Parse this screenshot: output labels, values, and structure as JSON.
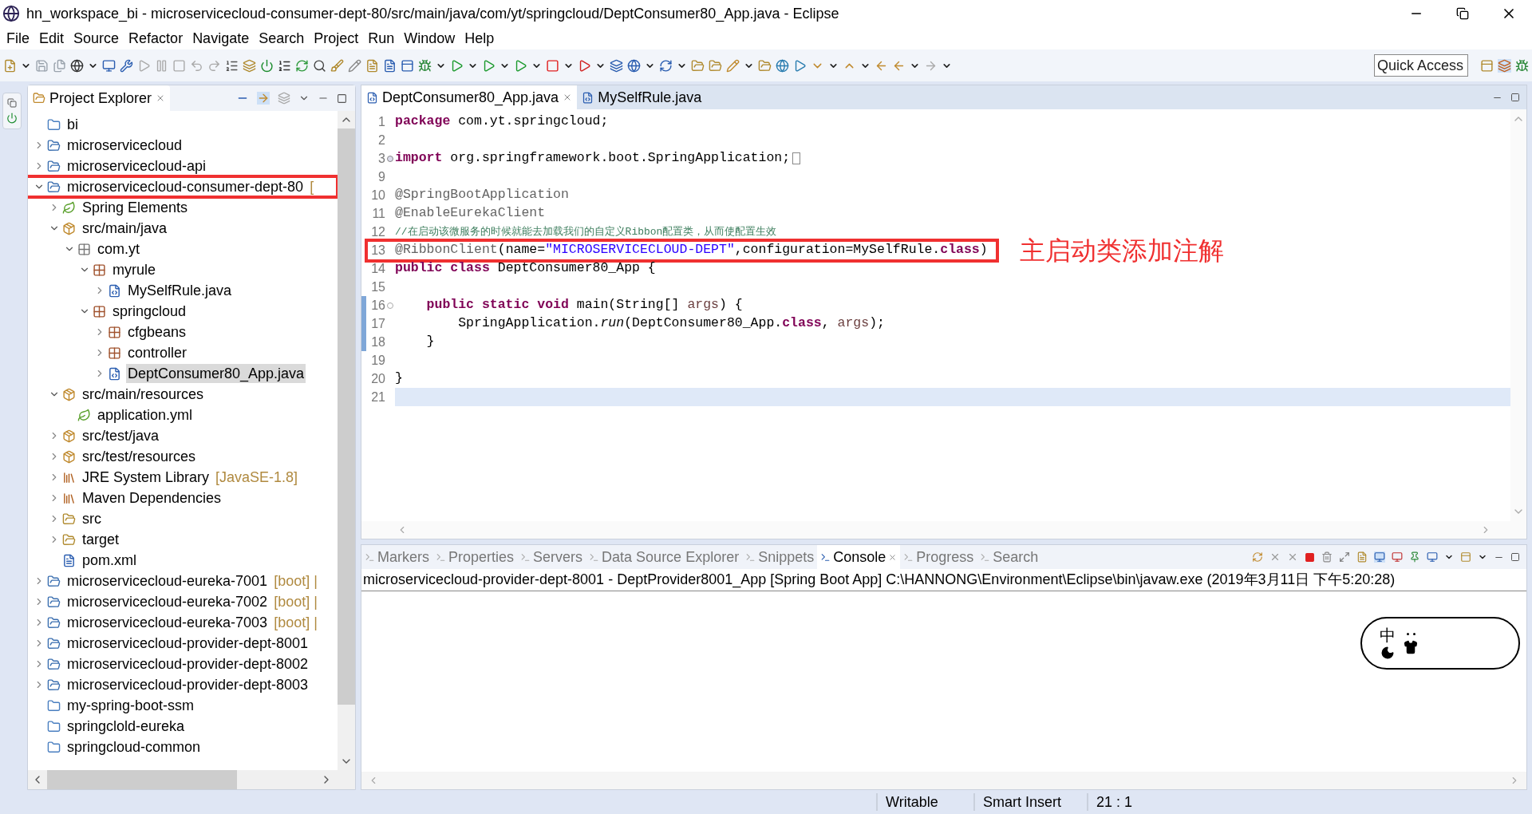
{
  "window": {
    "title": "hn_workspace_bi - microservicecloud-consumer-dept-80/src/main/java/com/yt/springcloud/DeptConsumer80_App.java - Eclipse"
  },
  "menu": [
    "File",
    "Edit",
    "Source",
    "Refactor",
    "Navigate",
    "Search",
    "Project",
    "Run",
    "Window",
    "Help"
  ],
  "quick_access": {
    "placeholder": "Quick Access"
  },
  "explorer": {
    "title": "Project Explorer",
    "tree": [
      {
        "label": "bi",
        "kind": "folder",
        "selected": false,
        "highlighted": false
      },
      {
        "label": "microservicecloud",
        "kind": "project",
        "expanded": false,
        "selected": false,
        "highlighted": false
      },
      {
        "label": "microservicecloud-api",
        "kind": "project",
        "expanded": false,
        "selected": false,
        "highlighted": false
      },
      {
        "label": "microservicecloud-consumer-dept-80",
        "decoration": "[",
        "kind": "project",
        "expanded": true,
        "selected": false,
        "highlighted": true,
        "children": [
          {
            "label": "Spring Elements",
            "kind": "spring",
            "expanded": false,
            "selected": false,
            "highlighted": false
          },
          {
            "label": "src/main/java",
            "kind": "source",
            "expanded": true,
            "selected": false,
            "highlighted": false,
            "children": [
              {
                "label": "com.yt",
                "kind": "package-empty",
                "expanded": true,
                "selected": false,
                "highlighted": false,
                "children": [
                  {
                    "label": "myrule",
                    "kind": "package",
                    "expanded": true,
                    "selected": false,
                    "highlighted": false,
                    "children": [
                      {
                        "label": "MySelfRule.java",
                        "kind": "java",
                        "expanded": false,
                        "selected": false,
                        "highlighted": false
                      }
                    ]
                  },
                  {
                    "label": "springcloud",
                    "kind": "package",
                    "expanded": true,
                    "selected": false,
                    "highlighted": false,
                    "children": [
                      {
                        "label": "cfgbeans",
                        "kind": "package",
                        "expanded": false,
                        "selected": false,
                        "highlighted": false
                      },
                      {
                        "label": "controller",
                        "kind": "package",
                        "expanded": false,
                        "selected": false,
                        "highlighted": false
                      },
                      {
                        "label": "DeptConsumer80_App.java",
                        "kind": "java",
                        "expanded": false,
                        "selected": true,
                        "highlighted": false
                      }
                    ]
                  }
                ]
              }
            ]
          },
          {
            "label": "src/main/resources",
            "kind": "source",
            "expanded": true,
            "selected": false,
            "highlighted": false,
            "children": [
              {
                "label": "application.yml",
                "kind": "yml",
                "selected": false,
                "highlighted": false
              }
            ]
          },
          {
            "label": "src/test/java",
            "kind": "source",
            "expanded": false,
            "selected": false,
            "highlighted": false
          },
          {
            "label": "src/test/resources",
            "kind": "source",
            "expanded": false,
            "selected": false,
            "highlighted": false
          },
          {
            "label": "JRE System Library",
            "decoration": "[JavaSE-1.8]",
            "kind": "library",
            "expanded": false,
            "selected": false,
            "highlighted": false
          },
          {
            "label": "Maven Dependencies",
            "kind": "library",
            "expanded": false,
            "selected": false,
            "highlighted": false
          },
          {
            "label": "src",
            "kind": "folder-open",
            "expanded": false,
            "selected": false,
            "highlighted": false
          },
          {
            "label": "target",
            "kind": "folder-open",
            "expanded": false,
            "selected": false,
            "highlighted": false
          },
          {
            "label": "pom.xml",
            "kind": "xml",
            "selected": false,
            "highlighted": false
          }
        ]
      },
      {
        "label": "microservicecloud-eureka-7001",
        "decoration": "[boot] |",
        "kind": "project",
        "expanded": false,
        "selected": false,
        "highlighted": false
      },
      {
        "label": "microservicecloud-eureka-7002",
        "decoration": "[boot] |",
        "kind": "project",
        "expanded": false,
        "selected": false,
        "highlighted": false
      },
      {
        "label": "microservicecloud-eureka-7003",
        "decoration": "[boot] |",
        "kind": "project",
        "expanded": false,
        "selected": false,
        "highlighted": false
      },
      {
        "label": "microservicecloud-provider-dept-8001",
        "kind": "project",
        "expanded": false,
        "selected": false,
        "highlighted": false
      },
      {
        "label": "microservicecloud-provider-dept-8002",
        "kind": "project",
        "expanded": false,
        "selected": false,
        "highlighted": false
      },
      {
        "label": "microservicecloud-provider-dept-8003",
        "kind": "project",
        "expanded": false,
        "selected": false,
        "highlighted": false
      },
      {
        "label": "my-spring-boot-ssm",
        "kind": "folder",
        "selected": false,
        "highlighted": false
      },
      {
        "label": "springclold-eureka",
        "kind": "folder",
        "selected": false,
        "highlighted": false
      },
      {
        "label": "springcloud-common",
        "kind": "folder",
        "selected": false,
        "highlighted": false
      }
    ]
  },
  "editor": {
    "tabs": [
      {
        "label": "DeptConsumer80_App.java",
        "selected": true
      },
      {
        "label": "MySelfRule.java",
        "selected": false
      }
    ],
    "lines": [
      {
        "number": "1",
        "changed": false,
        "highlighted": false,
        "current": false,
        "tokens": [
          {
            "kind": "keyword",
            "text": "package"
          },
          {
            "kind": "plain",
            "text": " com.yt.springcloud;"
          }
        ]
      },
      {
        "number": "2",
        "changed": false,
        "highlighted": false,
        "current": false
      },
      {
        "number": "3",
        "folded": true,
        "changed": false,
        "highlighted": false,
        "current": false,
        "tokens": [
          {
            "kind": "keyword",
            "text": "import"
          },
          {
            "kind": "plain",
            "text": " org.springframework.boot.SpringApplication;"
          }
        ]
      },
      {
        "number": "9",
        "changed": false,
        "highlighted": false,
        "current": false
      },
      {
        "number": "10",
        "changed": false,
        "highlighted": false,
        "current": false,
        "tokens": [
          {
            "kind": "annotation",
            "text": "@SpringBootApplication"
          }
        ]
      },
      {
        "number": "11",
        "changed": false,
        "highlighted": false,
        "current": false,
        "tokens": [
          {
            "kind": "annotation",
            "text": "@EnableEurekaClient"
          }
        ]
      },
      {
        "number": "12",
        "changed": false,
        "highlighted": false,
        "current": false,
        "tokens": [
          {
            "kind": "comment",
            "text": "//在启动该微服务的时候就能去加载我们的自定义Ribbon配置类，从而使配置生效"
          }
        ]
      },
      {
        "number": "13",
        "changed": false,
        "highlighted": true,
        "current": false,
        "note": "主启动类添加注解",
        "tokens": [
          {
            "kind": "annotation",
            "text": "@RibbonClient"
          },
          {
            "kind": "plain",
            "text": "(name="
          },
          {
            "kind": "string",
            "text": "\"MICROSERVICECLOUD-DEPT\""
          },
          {
            "kind": "plain",
            "text": ",configuration=MySelfRule."
          },
          {
            "kind": "keyword",
            "text": "class"
          },
          {
            "kind": "plain",
            "text": ")"
          }
        ]
      },
      {
        "number": "14",
        "changed": false,
        "highlighted": false,
        "current": false,
        "tokens": [
          {
            "kind": "keyword",
            "text": "public class"
          },
          {
            "kind": "plain",
            "text": " DeptConsumer80_App {"
          }
        ]
      },
      {
        "number": "15",
        "changed": false,
        "highlighted": false,
        "current": false
      },
      {
        "number": "16",
        "folded": false,
        "changed": true,
        "highlighted": false,
        "current": false,
        "tokens": [
          {
            "kind": "keyword",
            "text": "    public static void"
          },
          {
            "kind": "plain",
            "text": " main(String[] "
          },
          {
            "kind": "param",
            "text": "args"
          },
          {
            "kind": "plain",
            "text": ") {"
          }
        ]
      },
      {
        "number": "17",
        "changed": true,
        "highlighted": false,
        "current": false,
        "tokens": [
          {
            "kind": "plain",
            "text": "        SpringApplication."
          },
          {
            "kind": "italic",
            "text": "run"
          },
          {
            "kind": "plain",
            "text": "(DeptConsumer80_App."
          },
          {
            "kind": "keyword",
            "text": "class"
          },
          {
            "kind": "plain",
            "text": ", "
          },
          {
            "kind": "param",
            "text": "args"
          },
          {
            "kind": "plain",
            "text": ");"
          }
        ]
      },
      {
        "number": "18",
        "changed": true,
        "highlighted": false,
        "current": false,
        "tokens": [
          {
            "kind": "plain",
            "text": "    }"
          }
        ]
      },
      {
        "number": "19",
        "changed": false,
        "highlighted": false,
        "current": false
      },
      {
        "number": "20",
        "changed": false,
        "highlighted": false,
        "current": false,
        "tokens": [
          {
            "kind": "plain",
            "text": "}"
          }
        ]
      },
      {
        "number": "21",
        "changed": false,
        "highlighted": false,
        "current": true
      }
    ]
  },
  "console": {
    "tabs": [
      {
        "label": "Markers",
        "selected": false
      },
      {
        "label": "Properties",
        "selected": false
      },
      {
        "label": "Servers",
        "selected": false
      },
      {
        "label": "Data Source Explorer",
        "selected": false
      },
      {
        "label": "Snippets",
        "selected": false
      },
      {
        "label": "Console",
        "selected": true
      },
      {
        "label": "Progress",
        "selected": false
      },
      {
        "label": "Search",
        "selected": false
      }
    ],
    "launch": "microservicecloud-provider-dept-8001 - DeptProvider8001_App [Spring Boot App] C:\\HANNONG\\Environment\\Eclipse\\bin\\javaw.exe (2019年3月11日 下午5:20:28)",
    "ime": {
      "mode": "中"
    }
  },
  "status_bar": [
    "Writable",
    "Smart Insert",
    "21 : 1"
  ]
}
